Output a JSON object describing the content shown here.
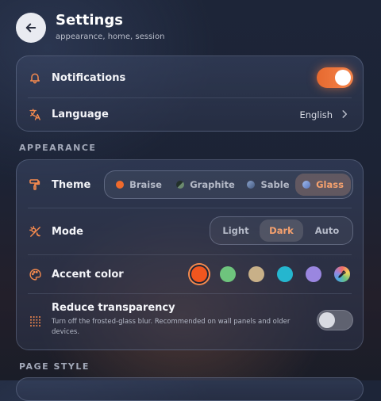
{
  "header": {
    "title": "Settings",
    "subtitle": "appearance, home, session",
    "back_icon": "arrow-left-icon"
  },
  "general": {
    "notifications": {
      "label": "Notifications",
      "icon": "bell-icon",
      "enabled": true
    },
    "language": {
      "label": "Language",
      "icon": "translate-icon",
      "value": "English"
    }
  },
  "appearance": {
    "section_label": "APPEARANCE",
    "theme": {
      "label": "Theme",
      "icon": "paint-roller-icon",
      "options": [
        {
          "label": "Braise",
          "color": "#f06a2c"
        },
        {
          "label": "Graphite",
          "color": "#3d4a3f"
        },
        {
          "label": "Sable",
          "color": "#6a84b0"
        },
        {
          "label": "Glass",
          "color": "#6f8fd0"
        }
      ],
      "selected": "Glass"
    },
    "mode": {
      "label": "Mode",
      "icon": "theme-toggle-icon",
      "options": [
        "Light",
        "Dark",
        "Auto"
      ],
      "selected": "Dark"
    },
    "accent": {
      "label": "Accent color",
      "icon": "palette-icon",
      "colors": [
        "#f0561f",
        "#6ec47d",
        "#c8b088",
        "#25b6cf",
        "#9a86e0"
      ],
      "selected_index": 0,
      "custom_icon": "eyedropper-icon"
    },
    "reduce_transparency": {
      "label": "Reduce transparency",
      "icon": "dot-grid-icon",
      "description": "Turn off the frosted-glass blur. Recommended on wall panels and older devices.",
      "enabled": false
    }
  },
  "page_style": {
    "section_label": "PAGE STYLE"
  },
  "colors": {
    "accent": "#f58a4e",
    "toggle_on": "#f07a3e",
    "toggle_off": "#5f6270"
  }
}
